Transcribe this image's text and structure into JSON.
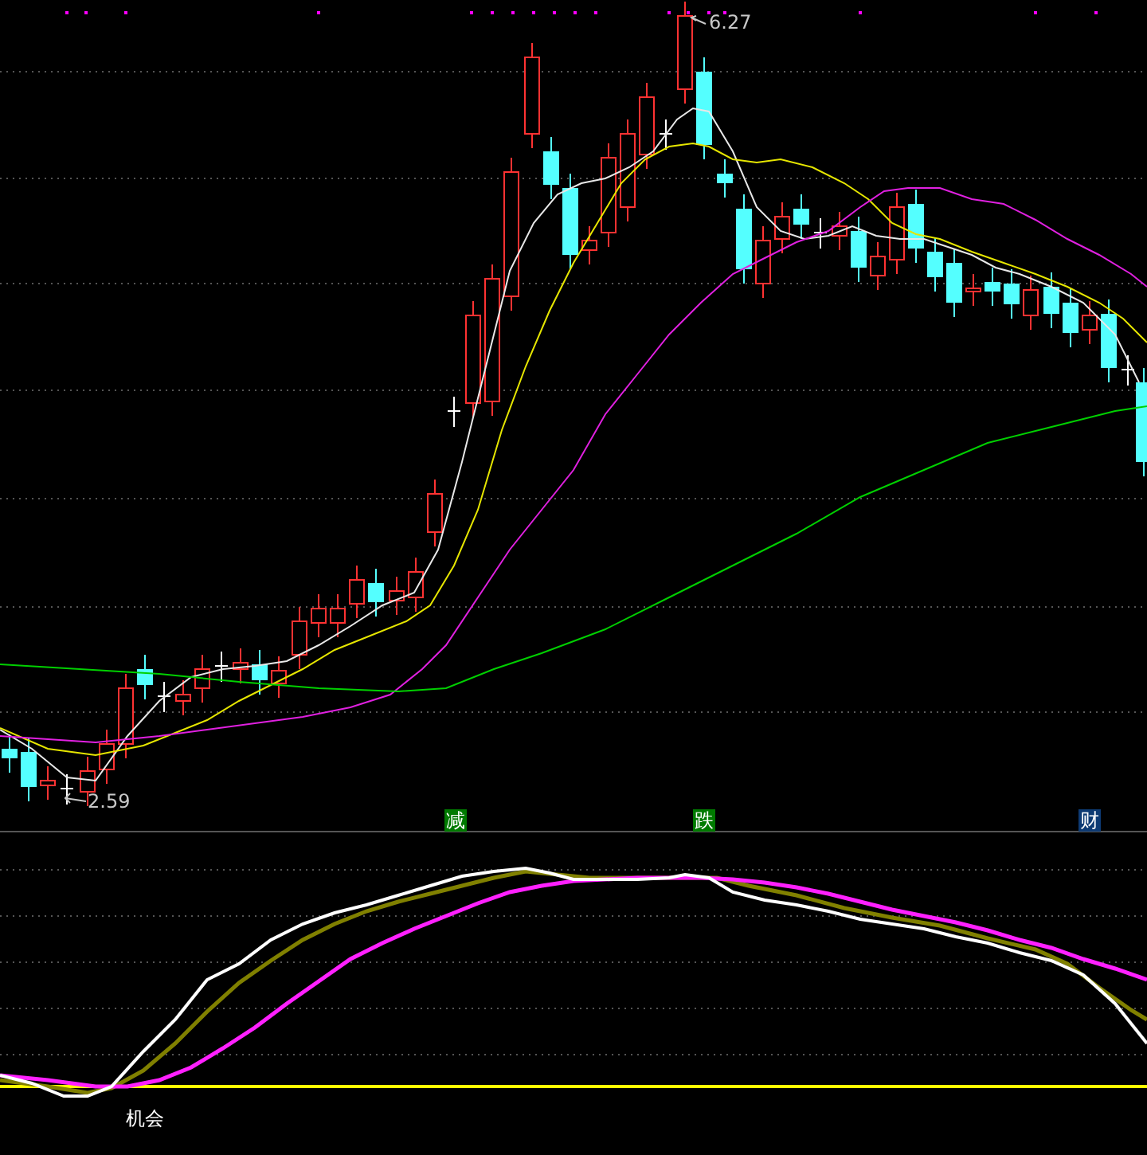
{
  "price_panel": {
    "high_label": "6.27",
    "low_label": "2.59",
    "signals": [
      {
        "text": "减",
        "color": "#007a00"
      },
      {
        "text": "跌",
        "color": "#007a00"
      },
      {
        "text": "财",
        "color": "#0d3a73"
      }
    ]
  },
  "indicator_panel": {
    "label": "机会"
  }
}
